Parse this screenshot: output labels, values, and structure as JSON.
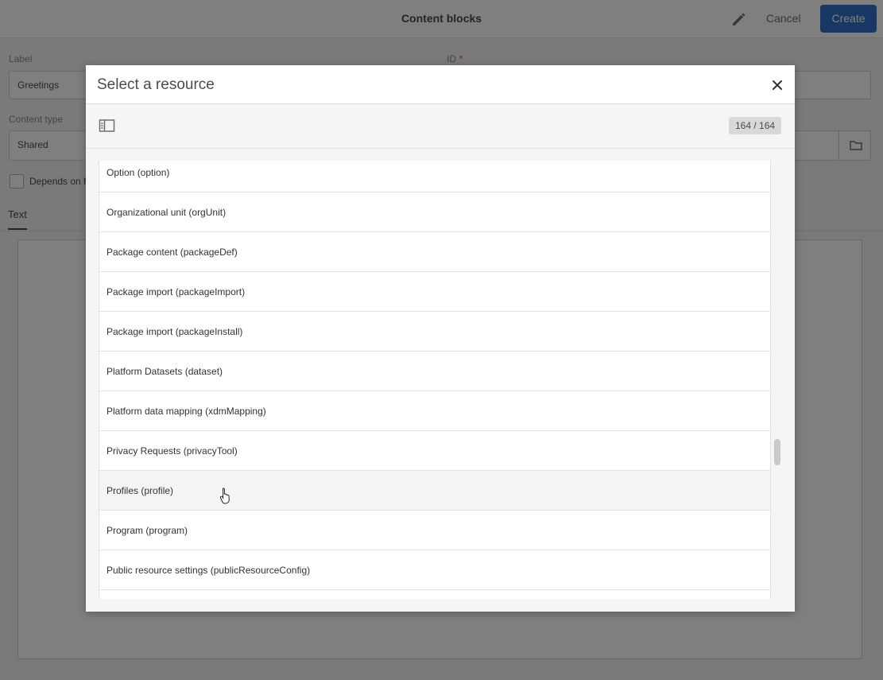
{
  "background": {
    "title": "Content blocks",
    "cancel_label": "Cancel",
    "create_label": "Create",
    "label_field": {
      "label": "Label",
      "value": "Greetings"
    },
    "id_field": {
      "label": "ID",
      "required_mark": "*"
    },
    "content_type_field": {
      "label": "Content type",
      "value": "Shared"
    },
    "depends_label": "Depends on f",
    "tab_text": "Text"
  },
  "modal": {
    "title": "Select a resource",
    "count": "164 / 164",
    "items": [
      "Option (option)",
      "Organizational unit (orgUnit)",
      "Package content (packageDef)",
      "Package import (packageImport)",
      "Package import (packageInstall)",
      "Platform Datasets (dataset)",
      "Platform data mapping (xdmMapping)",
      "Privacy Requests (privacyTool)",
      "Profiles (profile)",
      "Program (program)",
      "Public resource settings (publicResourceConfig)",
      ""
    ],
    "hovered_index": 8
  }
}
